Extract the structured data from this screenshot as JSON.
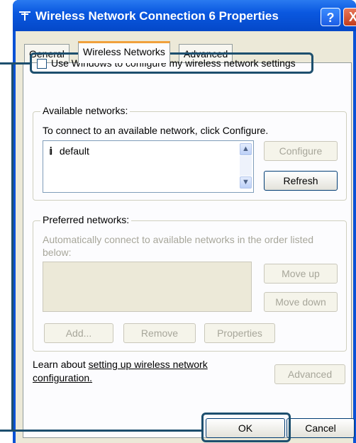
{
  "window": {
    "title": "Wireless Network Connection 6 Properties",
    "help_label": "?",
    "close_label": "X"
  },
  "tabs": [
    {
      "label": "General"
    },
    {
      "label": "Wireless Networks"
    },
    {
      "label": "Advanced"
    }
  ],
  "use_windows": {
    "label": "Use Windows to configure my wireless network settings",
    "checked": false
  },
  "available": {
    "title": "Available networks:",
    "instruction": "To connect to an available network, click Configure.",
    "networks": [
      {
        "name": "default",
        "icon": "antenna-icon"
      }
    ],
    "configure_label": "Configure",
    "refresh_label": "Refresh"
  },
  "preferred": {
    "title": "Preferred networks:",
    "desc_line1": "Automatically connect to available networks in the order listed",
    "desc_line2": "below:",
    "move_up_label": "Move up",
    "move_down_label": "Move down",
    "add_label": "Add...",
    "remove_label": "Remove",
    "properties_label": "Properties"
  },
  "learn": {
    "prefix": "Learn about ",
    "link1": "setting up wireless network",
    "link2": "configuration."
  },
  "advanced_label": "Advanced",
  "ok_label": "OK",
  "cancel_label": "Cancel"
}
